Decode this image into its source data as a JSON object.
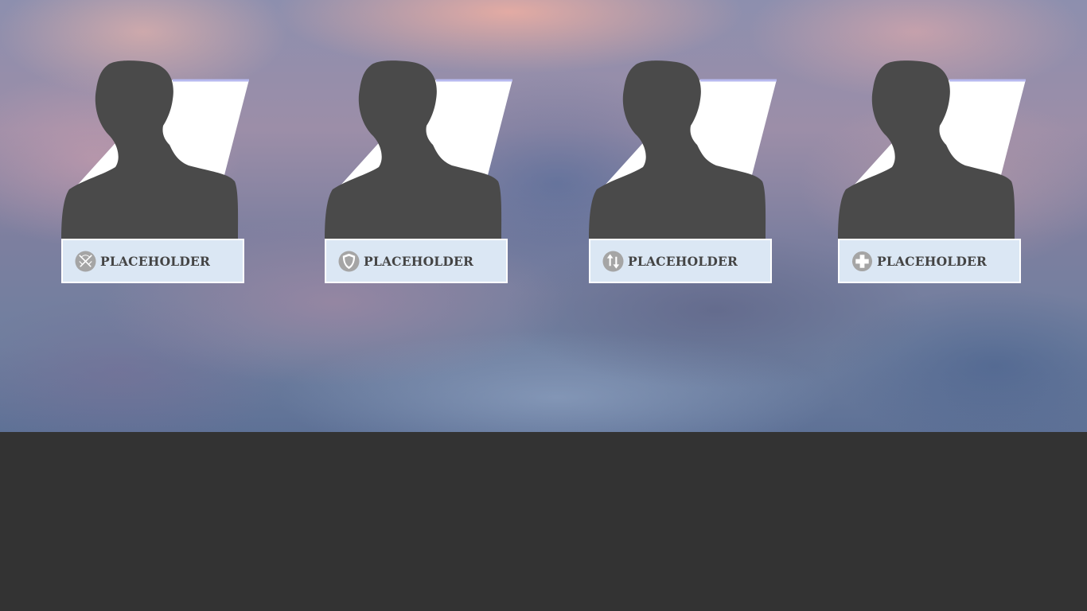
{
  "cards": [
    {
      "name": "PLACEHOLDER",
      "icon": "crossed-swords-icon"
    },
    {
      "name": "PLACEHOLDER",
      "icon": "shield-icon"
    },
    {
      "name": "PLACEHOLDER",
      "icon": "up-down-arrows-icon"
    },
    {
      "name": "PLACEHOLDER",
      "icon": "health-cross-icon"
    }
  ],
  "colors": {
    "silhouette": "#4a4a4a",
    "nameplate": "#dbe7f4",
    "icon": "#a5a5a5",
    "text": "#444444",
    "panel": "#333333"
  }
}
